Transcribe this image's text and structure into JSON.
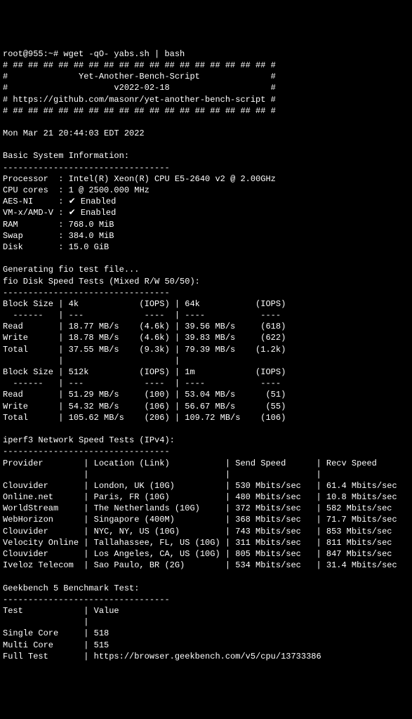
{
  "prompt": "root@955:~# wget -qO- yabs.sh | bash",
  "banner": {
    "line1": "# ## ## ## ## ## ## ## ## ## ## ## ## ## ## ## ## ## #",
    "line2": "#              Yet-Another-Bench-Script              #",
    "line3": "#                     v2022-02-18                    #",
    "line4": "# https://github.com/masonr/yet-another-bench-script #",
    "line5": "# ## ## ## ## ## ## ## ## ## ## ## ## ## ## ## ## ## #"
  },
  "timestamp": "Mon Mar 21 20:44:03 EDT 2022",
  "sysinfo_header": "Basic System Information:",
  "sysinfo_divider": "---------------------------------",
  "sysinfo": {
    "processor_label": "Processor",
    "processor_value": "Intel(R) Xeon(R) CPU E5-2640 v2 @ 2.00GHz",
    "cores_label": "CPU cores",
    "cores_value": "1 @ 2500.000 MHz",
    "aesni_label": "AES-NI",
    "aesni_value": "Enabled",
    "vmx_label": "VM-x/AMD-V",
    "vmx_value": "Enabled",
    "ram_label": "RAM",
    "ram_value": "768.0 MiB",
    "swap_label": "Swap",
    "swap_value": "384.0 MiB",
    "disk_label": "Disk",
    "disk_value": "15.0 GiB"
  },
  "fio_generating": "Generating fio test file...",
  "fio_header": "fio Disk Speed Tests (Mixed R/W 50/50):",
  "fio_divider": "---------------------------------",
  "fio_table1": {
    "header": "Block Size | 4k            (IOPS) | 64k           (IOPS)",
    "divider": "  ------   | ---            ----  | ----           ---- ",
    "read": "Read       | 18.77 MB/s    (4.6k) | 39.56 MB/s     (618)",
    "write": "Write      | 18.78 MB/s    (4.6k) | 39.83 MB/s     (622)",
    "total": "Total      | 37.55 MB/s    (9.3k) | 79.39 MB/s    (1.2k)"
  },
  "fio_spacer": "           |                      |                     ",
  "fio_table2": {
    "header": "Block Size | 512k          (IOPS) | 1m            (IOPS)",
    "divider": "  ------   | ---            ----  | ----           ---- ",
    "read": "Read       | 51.29 MB/s     (100) | 53.04 MB/s      (51)",
    "write": "Write      | 54.32 MB/s     (106) | 56.67 MB/s      (55)",
    "total": "Total      | 105.62 MB/s    (206) | 109.72 MB/s    (106)"
  },
  "iperf_header": "iperf3 Network Speed Tests (IPv4):",
  "iperf_divider": "---------------------------------",
  "iperf_table": {
    "header": "Provider        | Location (Link)           | Send Speed      | Recv Speed     ",
    "divider": "                |                           |                 |                ",
    "row1": "Clouvider       | London, UK (10G)          | 530 Mbits/sec   | 61.4 Mbits/sec ",
    "row2": "Online.net      | Paris, FR (10G)           | 480 Mbits/sec   | 10.8 Mbits/sec ",
    "row3": "WorldStream     | The Netherlands (10G)     | 372 Mbits/sec   | 582 Mbits/sec  ",
    "row4": "WebHorizon      | Singapore (400M)          | 368 Mbits/sec   | 71.7 Mbits/sec ",
    "row5": "Clouvider       | NYC, NY, US (10G)         | 743 Mbits/sec   | 853 Mbits/sec  ",
    "row6": "Velocity Online | Tallahassee, FL, US (10G) | 311 Mbits/sec   | 811 Mbits/sec  ",
    "row7": "Clouvider       | Los Angeles, CA, US (10G) | 805 Mbits/sec   | 847 Mbits/sec  ",
    "row8": "Iveloz Telecom  | Sao Paulo, BR (2G)        | 534 Mbits/sec   | 31.4 Mbits/sec "
  },
  "geekbench_header": "Geekbench 5 Benchmark Test:",
  "geekbench_divider": "---------------------------------",
  "geekbench": {
    "header": "Test            | Value                         ",
    "divider": "                |                               ",
    "single": "Single Core     | 518                           ",
    "multi": "Multi Core      | 515                           ",
    "full": "Full Test       | https://browser.geekbench.com/v5/cpu/13733386"
  }
}
